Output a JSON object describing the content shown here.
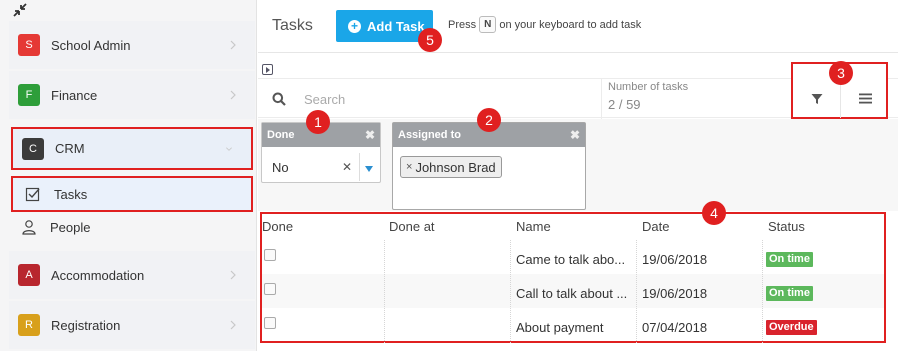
{
  "colors": {
    "accent": "#1aa6e8",
    "highlight": "#e02020",
    "on_time": "#5cb85c",
    "overdue": "#d9232d"
  },
  "sidebar": {
    "items": [
      {
        "letter": "S",
        "label": "School Admin",
        "color": "#e53935"
      },
      {
        "letter": "F",
        "label": "Finance",
        "color": "#2e9e3a"
      },
      {
        "letter": "C",
        "label": "CRM",
        "color": "#3b3b3b"
      },
      {
        "letter": "A",
        "label": "Accommodation",
        "color": "#b8262e"
      },
      {
        "letter": "R",
        "label": "Registration",
        "color": "#d8a01c"
      }
    ],
    "sub_items": [
      {
        "label": "Tasks",
        "icon": "checkbox-icon"
      },
      {
        "label": "People",
        "icon": "person-icon"
      }
    ]
  },
  "header": {
    "title": "Tasks",
    "add_button": "Add Task",
    "hint_pre": "Press",
    "hint_key": "N",
    "hint_post": "on your keyboard to add task"
  },
  "search": {
    "placeholder": "Search",
    "count_label": "Number of tasks",
    "count_value": "2 / 59"
  },
  "filters": {
    "done": {
      "title": "Done",
      "value": "No"
    },
    "assigned": {
      "title": "Assigned to",
      "tag": "Johnson Brad"
    }
  },
  "table": {
    "columns": [
      "Done",
      "Done at",
      "Name",
      "Date",
      "Status"
    ],
    "rows": [
      {
        "done_at": "",
        "name": "Came to talk abo...",
        "date": "19/06/2018",
        "status": "On time"
      },
      {
        "done_at": "",
        "name": "Call to talk about ...",
        "date": "19/06/2018",
        "status": "On time"
      },
      {
        "done_at": "",
        "name": "About payment",
        "date": "07/04/2018",
        "status": "Overdue"
      }
    ]
  },
  "badges": [
    "1",
    "2",
    "3",
    "4",
    "5"
  ]
}
